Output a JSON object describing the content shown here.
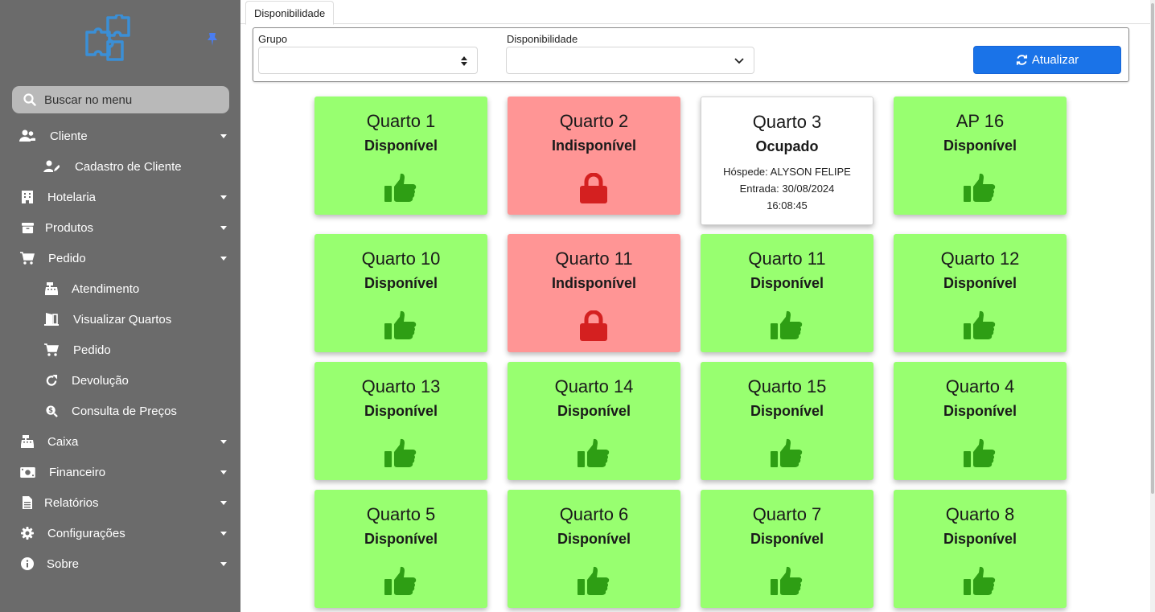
{
  "sidebar": {
    "search_placeholder": "Buscar no menu",
    "items": [
      {
        "label": "Cliente",
        "icon": "users-icon",
        "has_caret": true
      },
      {
        "label": "Cadastro de Cliente",
        "icon": "user-edit-icon",
        "sub": true
      },
      {
        "label": "Hotelaria",
        "icon": "building-icon",
        "has_caret": true
      },
      {
        "label": "Produtos",
        "icon": "box-icon",
        "has_caret": true
      },
      {
        "label": "Pedido",
        "icon": "cart-icon",
        "has_caret": true
      },
      {
        "label": "Atendimento",
        "icon": "cash-register-icon",
        "sub": true
      },
      {
        "label": "Visualizar Quartos",
        "icon": "door-open-icon",
        "sub": true
      },
      {
        "label": "Pedido",
        "icon": "cart-icon",
        "sub": true
      },
      {
        "label": "Devolução",
        "icon": "redo-icon",
        "sub": true
      },
      {
        "label": "Consulta de Preços",
        "icon": "search-dollar-icon",
        "sub": true
      },
      {
        "label": "Caixa",
        "icon": "cash-register-icon",
        "has_caret": true
      },
      {
        "label": "Financeiro",
        "icon": "money-bill-icon",
        "has_caret": true
      },
      {
        "label": "Relatórios",
        "icon": "file-icon",
        "has_caret": true
      },
      {
        "label": "Configurações",
        "icon": "gear-icon",
        "has_caret": true
      },
      {
        "label": "Sobre",
        "icon": "info-icon",
        "has_caret": true
      }
    ]
  },
  "tab": {
    "label": "Disponibilidade"
  },
  "filters": {
    "grupo_label": "Grupo",
    "grupo_value": "",
    "disponibilidade_label": "Disponibilidade",
    "disponibilidade_value": "",
    "refresh_label": "Atualizar"
  },
  "colors": {
    "sidebar": "#6b6b6b",
    "available": "#98ff70",
    "unavailable": "#ff9595",
    "occupied": "#ffffff",
    "accent": "#1a73e8",
    "thumbs": "#2e9e14",
    "lock": "#d42020"
  },
  "rooms": [
    {
      "name": "Quarto 1",
      "status": "Disponível",
      "state": "available"
    },
    {
      "name": "Quarto 2",
      "status": "Indisponível",
      "state": "unavailable"
    },
    {
      "name": "Quarto 3",
      "status": "Ocupado",
      "state": "occupied",
      "guest": "Hóspede: ALYSON FELIPE",
      "entry": "Entrada: 30/08/2024",
      "time": "16:08:45"
    },
    {
      "name": "AP 16",
      "status": "Disponível",
      "state": "available"
    },
    {
      "name": "Quarto 10",
      "status": "Disponível",
      "state": "available"
    },
    {
      "name": "Quarto 11",
      "status": "Indisponível",
      "state": "unavailable"
    },
    {
      "name": "Quarto 11",
      "status": "Disponível",
      "state": "available"
    },
    {
      "name": "Quarto 12",
      "status": "Disponível",
      "state": "available"
    },
    {
      "name": "Quarto 13",
      "status": "Disponível",
      "state": "available"
    },
    {
      "name": "Quarto 14",
      "status": "Disponível",
      "state": "available"
    },
    {
      "name": "Quarto 15",
      "status": "Disponível",
      "state": "available"
    },
    {
      "name": "Quarto 4",
      "status": "Disponível",
      "state": "available"
    },
    {
      "name": "Quarto 5",
      "status": "Disponível",
      "state": "available"
    },
    {
      "name": "Quarto 6",
      "status": "Disponível",
      "state": "available"
    },
    {
      "name": "Quarto 7",
      "status": "Disponível",
      "state": "available"
    },
    {
      "name": "Quarto 8",
      "status": "Disponível",
      "state": "available"
    }
  ]
}
